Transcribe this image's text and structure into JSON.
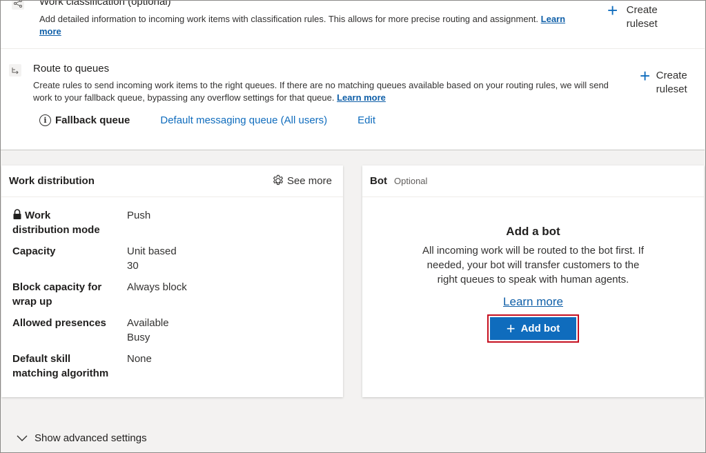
{
  "work_classification": {
    "title": "Work classification (optional)",
    "description": "Add detailed information to incoming work items with classification rules. This allows for more precise routing and assignment.",
    "learn_more_line1": "Learn",
    "learn_more_line2": "more",
    "create_line1": "Create",
    "create_line2": "ruleset",
    "icon": "share-nodes-icon"
  },
  "route_to_queues": {
    "title": "Route to queues",
    "description_line1": "Create rules to send incoming work items to the right queues. If there are no matching queues available based on your routing rules, we will send",
    "description_line2": "work to your fallback queue, bypassing any overflow settings for that queue.",
    "learn_more": "Learn more",
    "create_line1": "Create",
    "create_line2": "ruleset",
    "icon": "route-arrows-icon"
  },
  "fallback": {
    "label": "Fallback queue",
    "value": "Default messaging queue (All users)",
    "edit": "Edit"
  },
  "work_distribution": {
    "title": "Work distribution",
    "see_more": "See more",
    "rows": [
      {
        "key_line1": "Work",
        "key_line2": "distribution mode",
        "value_line1": "Push",
        "value_line2": ""
      },
      {
        "key_line1": "Capacity",
        "key_line2": "",
        "value_line1": "Unit based",
        "value_line2": "30"
      },
      {
        "key_line1": "Block capacity for",
        "key_line2": "wrap up",
        "value_line1": "Always block",
        "value_line2": ""
      },
      {
        "key_line1": "Allowed presences",
        "key_line2": "",
        "value_line1": "Available",
        "value_line2": "Busy"
      },
      {
        "key_line1": "Default skill",
        "key_line2": "matching algorithm",
        "value_line1": "None",
        "value_line2": ""
      }
    ]
  },
  "bot": {
    "title": "Bot",
    "optional": "Optional",
    "heading": "Add a bot",
    "description": "All incoming work will be routed to the bot first. If needed, your bot will transfer customers to the right queues to speak with human agents.",
    "learn_more": "Learn more",
    "add_button": "Add bot"
  },
  "advanced": {
    "label": "Show advanced settings"
  },
  "colors": {
    "accent": "#0f6cbd",
    "highlight_border": "#c50f1f",
    "link": "#0f5fa8"
  }
}
